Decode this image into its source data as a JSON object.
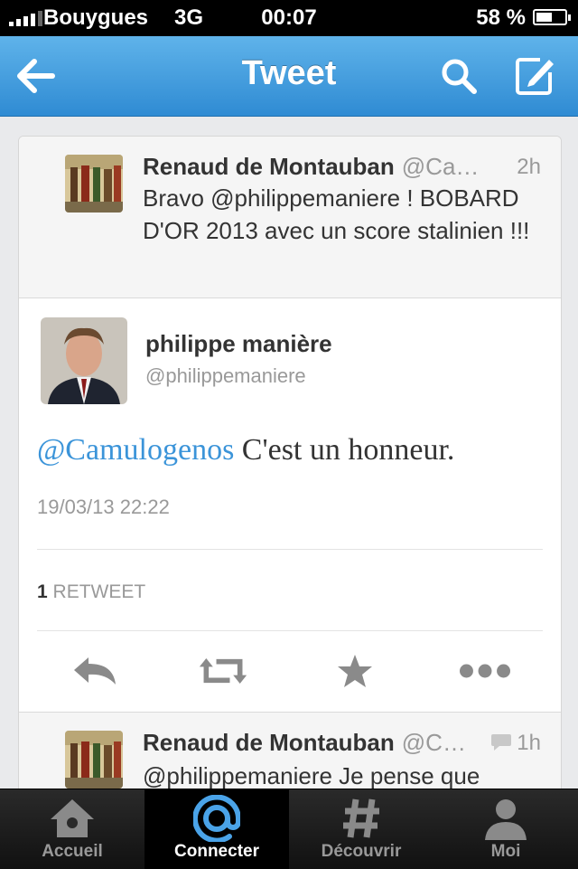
{
  "status_bar": {
    "carrier": "Bouygues",
    "network": "3G",
    "time": "00:07",
    "battery": "58 %",
    "battery_level": 0.58
  },
  "nav": {
    "title": "Tweet",
    "back_icon": "back-arrow-icon",
    "search_icon": "search-icon",
    "compose_icon": "compose-icon"
  },
  "reply_above": {
    "name": "Renaud de Montauban",
    "handle": "@Ca…",
    "time": "2h",
    "text": "Bravo @philippemaniere ! BOBARD D'OR 2013 avec un score stalinien !!!"
  },
  "main_tweet": {
    "name": "philippe manière",
    "handle": "@philippemaniere",
    "mention": "@Camulogenos",
    "text": " C'est un honneur.",
    "date": "19/03/13 22:22",
    "retweet_count": "1",
    "retweet_label": "RETWEET"
  },
  "actions": [
    "reply-icon",
    "retweet-icon",
    "favorite-icon",
    "more-icon"
  ],
  "reply_below": {
    "name": "Renaud de Montauban",
    "handle": "@C…",
    "time": "1h",
    "text": "@philippemaniere Je pense que"
  },
  "tabs": [
    {
      "label": "Accueil",
      "icon": "home-icon"
    },
    {
      "label": "Connecter",
      "icon": "at-icon",
      "active": true
    },
    {
      "label": "Découvrir",
      "icon": "hash-icon"
    },
    {
      "label": "Moi",
      "icon": "person-icon"
    }
  ],
  "colors": {
    "nav_blue": "#2f8bd3",
    "mention_blue": "#3b94d9",
    "active_tab_icon": "#4aa3e8"
  }
}
